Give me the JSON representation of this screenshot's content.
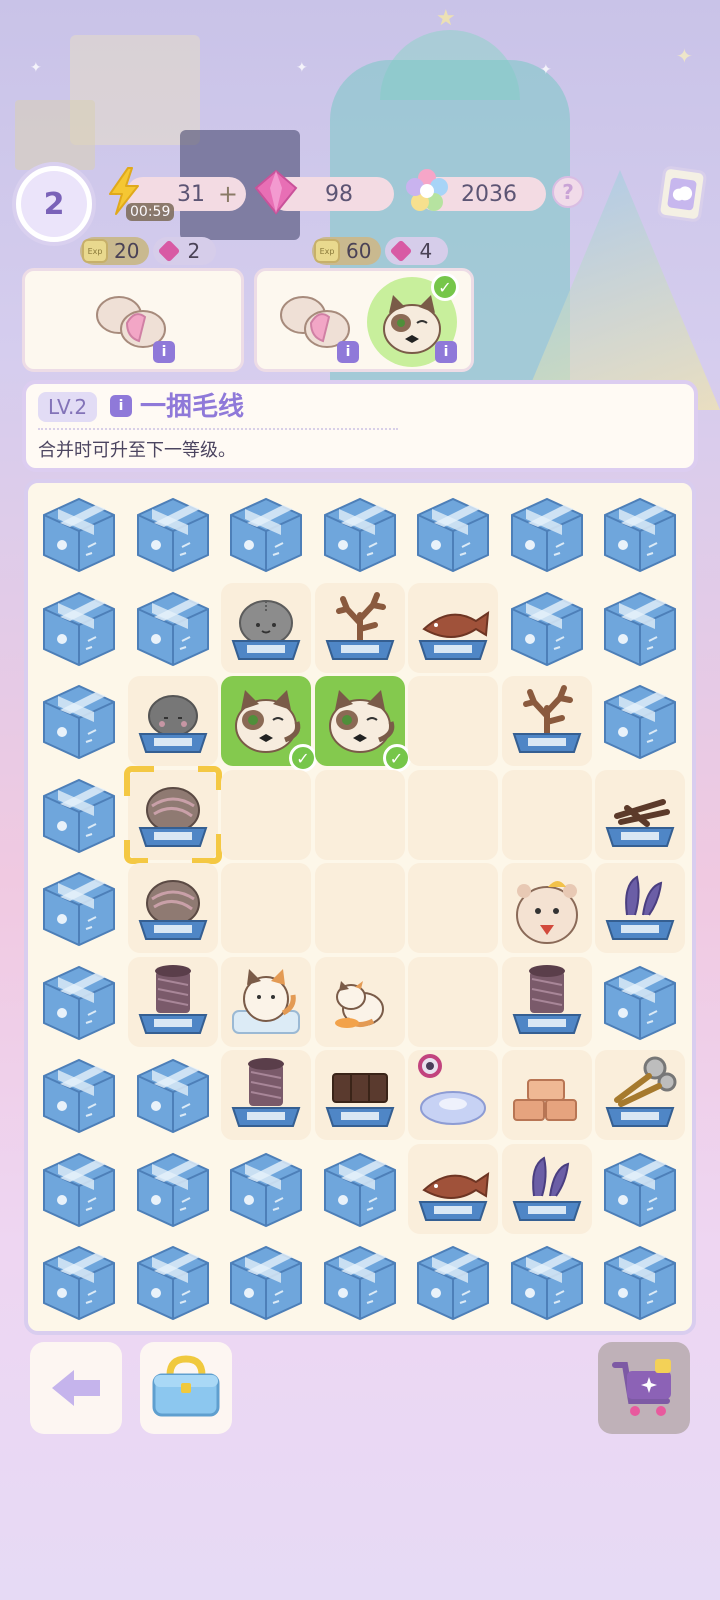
{
  "hud": {
    "level": "2",
    "energy": "31",
    "energy_plus": "+",
    "energy_timer": "00:59",
    "gems": "98",
    "stars": "2036",
    "help": "?"
  },
  "orders": [
    {
      "coins": "20",
      "gems": "2"
    },
    {
      "coins": "60",
      "gems": "4"
    }
  ],
  "info_panel": {
    "level_tag": "LV.2",
    "item_name": "一捆毛线",
    "description": "合并时可升至下一等级。"
  },
  "info_icon": "i",
  "board": {
    "rows": [
      [
        "box",
        "box",
        "box",
        "box",
        "box",
        "box",
        "box"
      ],
      [
        "box",
        "box",
        "rock",
        "coral",
        "fish",
        "box",
        "box"
      ],
      [
        "box",
        "rock-small",
        "cat",
        "cat",
        "empty",
        "coral",
        "box"
      ],
      [
        "box",
        "yarn-selected",
        "empty",
        "empty",
        "empty",
        "empty",
        "sticks"
      ],
      [
        "box",
        "yarn",
        "empty",
        "empty",
        "empty",
        "hamster",
        "flower-bin"
      ],
      [
        "box",
        "spool",
        "cat-bed",
        "cat-small",
        "empty",
        "spool",
        "box"
      ],
      [
        "box",
        "box",
        "spool",
        "chocolate",
        "cushion",
        "soap",
        "scissors"
      ],
      [
        "box",
        "box",
        "box",
        "box",
        "fish",
        "flower-bin",
        "box"
      ],
      [
        "box",
        "box",
        "box",
        "box",
        "box",
        "box",
        "box"
      ]
    ]
  },
  "colors": {
    "accent": "#8f79d9",
    "green": "#84c94e",
    "selection": "#f4c843"
  }
}
